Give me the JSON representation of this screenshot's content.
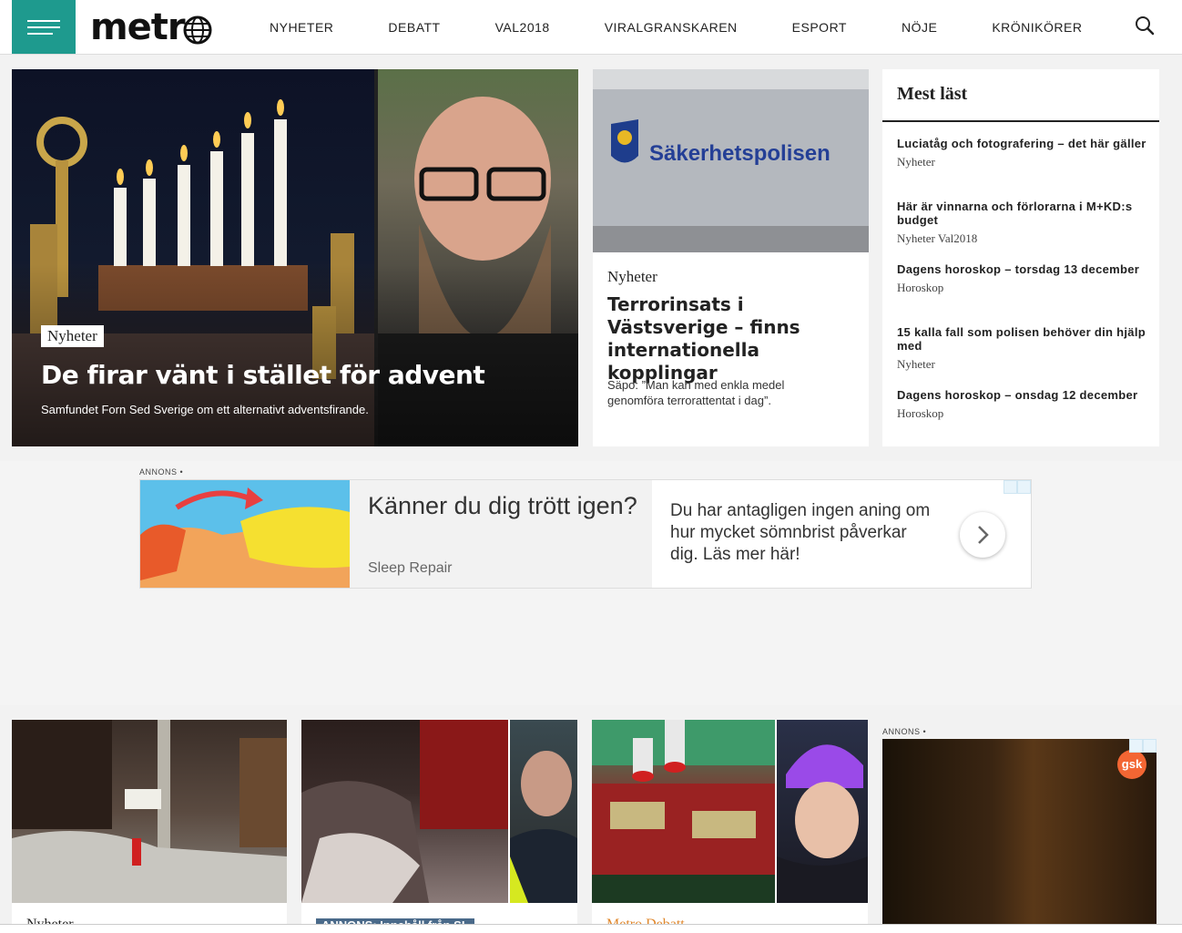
{
  "header": {
    "logo": "metr",
    "nav": [
      "NYHETER",
      "DEBATT",
      "VAL2018",
      "VIRALGRANSKAREN",
      "ESPORT",
      "NÖJE",
      "KRÖNIKÖRER"
    ]
  },
  "hero": {
    "tag": "Nyheter",
    "title": "De firar vänt i stället för advent",
    "subtitle": "Samfundet Forn Sed Sverige om ett alternativt adventsfirande."
  },
  "card2": {
    "sign_text": "Säkerhetspolisen",
    "kicker": "Nyheter",
    "title": "Terrorinsats i Västsverige – finns internationella kopplingar",
    "subtitle": "Säpo: ”Man kan med enkla medel genomföra terrorattentat i dag”."
  },
  "mostread": {
    "heading": "Mest läst",
    "items": [
      {
        "title": "Luciatåg och fotografering – det här gäller",
        "tag": "Nyheter"
      },
      {
        "title": "Här är vinnarna och förlorarna i M+KD:s budget",
        "tag": "Nyheter  Val2018"
      },
      {
        "title": "Dagens horoskop – torsdag 13 december",
        "tag": "Horoskop"
      },
      {
        "title": "15 kalla fall som polisen behöver din hjälp med",
        "tag": "Nyheter"
      },
      {
        "title": "Dagens horoskop – onsdag 12 december",
        "tag": "Horoskop"
      }
    ]
  },
  "ad": {
    "label": "ANNONS",
    "title": "Känner du dig trött igen?",
    "brand": "Sleep Repair",
    "text": "Du har antagligen ingen aning om hur mycket sömnbrist påverkar dig. Läs mer här!"
  },
  "bottom": {
    "card1_kicker": "Nyheter",
    "card2_kicker": "ANNONS: Innehåll från SL",
    "card3_kicker": "Metro Debatt",
    "ad_label": "ANNONS",
    "ad_brand": "gsk"
  },
  "colors": {
    "brand_teal": "#1e9a8e",
    "debatt_orange": "#e0872b"
  }
}
